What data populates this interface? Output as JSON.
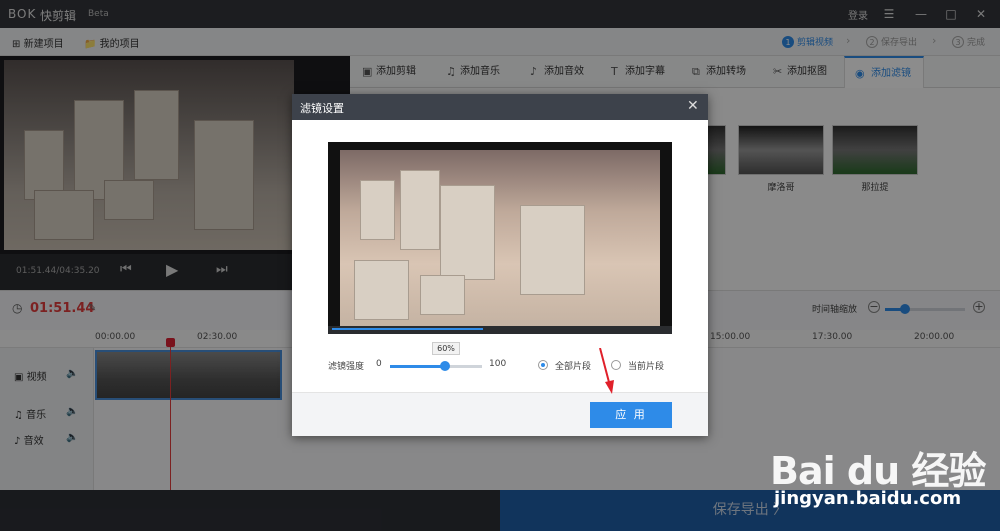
{
  "app": {
    "logo": "BOK",
    "name": "快剪辑",
    "version": "Beta",
    "login": "登录"
  },
  "toolbar": {
    "new_project": "新建项目",
    "my_projects": "我的项目"
  },
  "steps": [
    {
      "num": "1",
      "label": "剪辑视频"
    },
    {
      "num": "2",
      "label": "保存导出"
    },
    {
      "num": "3",
      "label": "完成"
    }
  ],
  "preview": {
    "time": "01:51.44/04:35.20",
    "progress": 0.41
  },
  "tabs": [
    {
      "icon": "film-icon",
      "label": "添加剪辑"
    },
    {
      "icon": "music-icon",
      "label": "添加音乐"
    },
    {
      "icon": "sound-icon",
      "label": "添加音效"
    },
    {
      "icon": "text-icon",
      "label": "添加字幕"
    },
    {
      "icon": "transition-icon",
      "label": "添加转场"
    },
    {
      "icon": "cutout-icon",
      "label": "添加抠图"
    },
    {
      "icon": "filter-icon",
      "label": "添加滤镜"
    }
  ],
  "filters": [
    {
      "label": ""
    },
    {
      "label": "摩洛哥"
    },
    {
      "label": "那拉提"
    }
  ],
  "timeline": {
    "current": "01:51.44",
    "zoom_label": "时间轴缩放",
    "zoom_minus": "−",
    "zoom_plus": "+",
    "zoom_level": 0.25,
    "ticks": [
      "00:00.00",
      "02:30.00",
      "15:00.00",
      "17:30.00",
      "20:00.00"
    ],
    "tracks": [
      {
        "icon": "video-track-icon",
        "label": "视频"
      },
      {
        "icon": "music-track-icon",
        "label": "音乐"
      },
      {
        "icon": "sfx-track-icon",
        "label": "音效"
      }
    ]
  },
  "footer": {
    "save_export": "保存导出 〉"
  },
  "watermark": {
    "brand": "Bai du 经验",
    "url": "jingyan.baidu.com"
  },
  "dialog": {
    "title": "滤镜设置",
    "strength_label": "滤镜强度",
    "min": "0",
    "max": "100",
    "value_text": "60%",
    "value": 60,
    "video_progress": 0.45,
    "option_all": "全部片段",
    "option_current": "当前片段",
    "apply": "应 用"
  }
}
